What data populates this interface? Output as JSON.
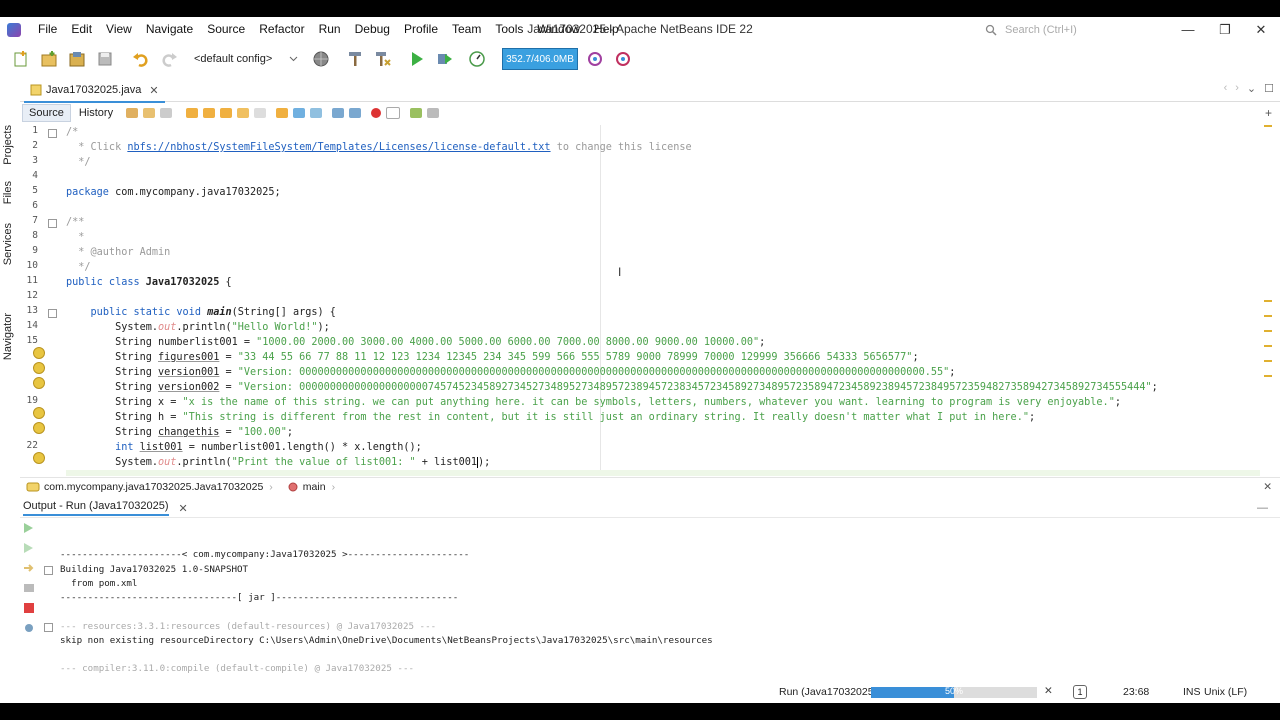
{
  "window": {
    "title": "Java17032025 - Apache NetBeans IDE 22",
    "search_placeholder": "Search (Ctrl+I)",
    "minimize": "—",
    "restore": "❐",
    "close": "✕"
  },
  "menu": [
    "File",
    "Edit",
    "View",
    "Navigate",
    "Source",
    "Refactor",
    "Run",
    "Debug",
    "Profile",
    "Team",
    "Tools",
    "Window",
    "Help"
  ],
  "toolbar": {
    "config_value": "<default config>",
    "memory": "352.7/406.0MB"
  },
  "sidebar": {
    "projects": "Projects",
    "files": "Files",
    "services": "Services",
    "navigator": "Navigator"
  },
  "editor": {
    "tab_label": "Java17032025.java",
    "tab_close": "✕",
    "source_label": "Source",
    "history_label": "History",
    "lines": {
      "l2_pre": "  * Click ",
      "l2_link": "nbfs://nbhost/SystemFileSystem/Templates/Licenses/license-default.txt",
      "l2_post": " to change this license",
      "l5_kw": "package",
      "l5_rest": " com.mycompany.java17032025;",
      "l9": "  * @author Admin",
      "l11_kw": "public class",
      "l11_name": "Java17032025",
      "l11_brace": " {",
      "l13_kw": "public static void",
      "l13_name": "main",
      "l13_rest": "(String[] args) {",
      "l14_a": "System.",
      "l14_out": "out",
      "l14_b": ".println(",
      "l14_str": "\"Hello World!\"",
      "l14_c": ");",
      "l15_a": "String numberlist001 = ",
      "l15_str": "\"1000.00 2000.00 3000.00 4000.00 5000.00 6000.00 7000.00 8000.00 9000.00 10000.00\"",
      "l16_a": "String ",
      "l16_var": "figures001",
      "l16_b": " = ",
      "l16_str": "\"33 44 55 66 77 88 11 12 123 1234 12345 234 345 599 566 555 5789 9000 78999 70000 129999 356666 54333 5656577\"",
      "l17_var": "version001",
      "l17_str": "\"Version: 000000000000000000000000000000000000000000000000000000000000000000000000000000000000000000000000000000.55\"",
      "l18_var": "version002",
      "l18_str": "\"Version: 000000000000000000000745745234589273452734895273489572389457238345723458927348957235894723458923894572384957235948273589427345892734555444\"",
      "l19_a": "String x = ",
      "l19_str": "\"x is the name of this string. we can put anything here. it can be symbols, letters, numbers, whatever you want. learning to program is very enjoyable.\"",
      "l20_a": "String h = ",
      "l20_str": "\"This string is different from the rest in content, but it is still just an ordinary string. It really doesn't matter what I put in here.\"",
      "l21_var": "changethis",
      "l21_str": "\"100.00\"",
      "l22_kw": "int",
      "l22_var": "list001",
      "l22_rest": " = numberlist001.length() * x.length();",
      "l23_str": "\"Print the value of list001: \"",
      "l23_rest": " + list001",
      "l23_end": ");",
      "semi": ";"
    }
  },
  "breadcrumb": {
    "class_path": "com.mycompany.java17032025.Java17032025",
    "method": "main"
  },
  "output": {
    "title": "Output - Run (Java17032025)",
    "close": "✕",
    "lines": [
      "----------------------< com.mycompany:Java17032025 >----------------------",
      "Building Java17032025 1.0-SNAPSHOT",
      "  from pom.xml",
      "--------------------------------[ jar ]---------------------------------",
      "",
      "--- resources:3.3.1:resources (default-resources) @ Java17032025 ---",
      "skip non existing resourceDirectory C:\\Users\\Admin\\OneDrive\\Documents\\NetBeansProjects\\Java17032025\\src\\main\\resources",
      "",
      "--- compiler:3.11.0:compile (default-compile) @ Java17032025 ---"
    ]
  },
  "status": {
    "task": "Run (Java17032025)",
    "progress_percent": 50,
    "progress_label": "50%",
    "cursor_pos": "23:68",
    "insert_mode": "INS",
    "line_ending": "Unix (LF)",
    "notifications": "1"
  },
  "colors": {
    "accent": "#3a8fd8",
    "keyword": "#2060c0",
    "string": "#4aa14a",
    "comment": "#9a9a9a",
    "memory_bar": "#3aa0e0"
  }
}
